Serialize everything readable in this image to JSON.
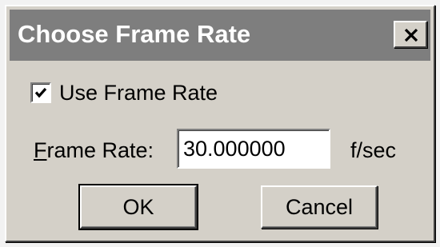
{
  "dialog": {
    "title": "Choose Frame Rate",
    "close_icon": "close-icon"
  },
  "use_frame_rate": {
    "label": "Use Frame Rate",
    "checked": true,
    "icon": "checkmark-icon"
  },
  "frame_rate": {
    "label_mnemonic": "F",
    "label_rest": "rame Rate:",
    "value": "30.000000",
    "unit": "f/sec"
  },
  "buttons": {
    "ok_label": "OK",
    "cancel_label": "Cancel"
  }
}
